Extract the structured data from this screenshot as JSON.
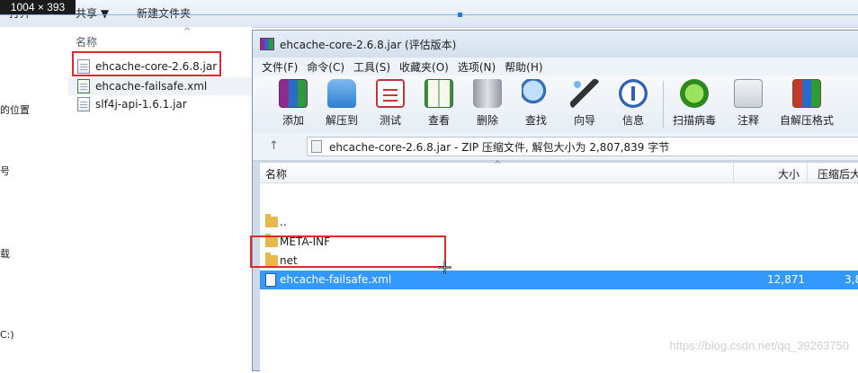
{
  "overlay": {
    "dimensions": "1004 × 393"
  },
  "explorer": {
    "toolbar": {
      "share": "共享 ▼",
      "new_folder": "新建文件夹",
      "open_partial": "打开"
    },
    "nav": {
      "item1": "的位置",
      "item2": "号",
      "item3": "载",
      "item4": "C:)"
    },
    "list_header": {
      "name": "名称"
    },
    "files": [
      {
        "name": "ehcache-core-2.6.8.jar"
      },
      {
        "name": "ehcache-failsafe.xml"
      },
      {
        "name": "slf4j-api-1.6.1.jar"
      }
    ]
  },
  "winrar": {
    "title": "ehcache-core-2.6.8.jar (评估版本)",
    "menu": [
      "文件(F)",
      "命令(C)",
      "工具(S)",
      "收藏夹(O)",
      "选项(N)",
      "帮助(H)"
    ],
    "toolbar": [
      {
        "label": "添加",
        "icon": "add-archive-icon"
      },
      {
        "label": "解压到",
        "icon": "extract-to-icon"
      },
      {
        "label": "测试",
        "icon": "test-icon"
      },
      {
        "label": "查看",
        "icon": "view-book-icon"
      },
      {
        "label": "删除",
        "icon": "trash-icon"
      },
      {
        "label": "查找",
        "icon": "magnifier-icon"
      },
      {
        "label": "向导",
        "icon": "wizard-wand-icon"
      },
      {
        "label": "信息",
        "icon": "info-icon"
      },
      {
        "label": "扫描病毒",
        "icon": "virus-scan-icon"
      },
      {
        "label": "注释",
        "icon": "comment-icon"
      },
      {
        "label": "自解压格式",
        "icon": "sfx-icon"
      }
    ],
    "address": "ehcache-core-2.6.8.jar - ZIP 压缩文件, 解包大小为 2,807,839 字节",
    "columns": {
      "name": "名称",
      "size": "大小",
      "packed": "压缩后大"
    },
    "rows": [
      {
        "name": "..",
        "size": "",
        "packed": ""
      },
      {
        "name": "META-INF",
        "size": "",
        "packed": ""
      },
      {
        "name": "net",
        "size": "",
        "packed": ""
      },
      {
        "name": "ehcache-failsafe.xml",
        "size": "12,871",
        "packed": "3,8"
      }
    ]
  },
  "watermark": "https://blog.csdn.net/qq_39263750",
  "colors": {
    "highlight": "#e02b2b",
    "selection": "#3399ff"
  }
}
